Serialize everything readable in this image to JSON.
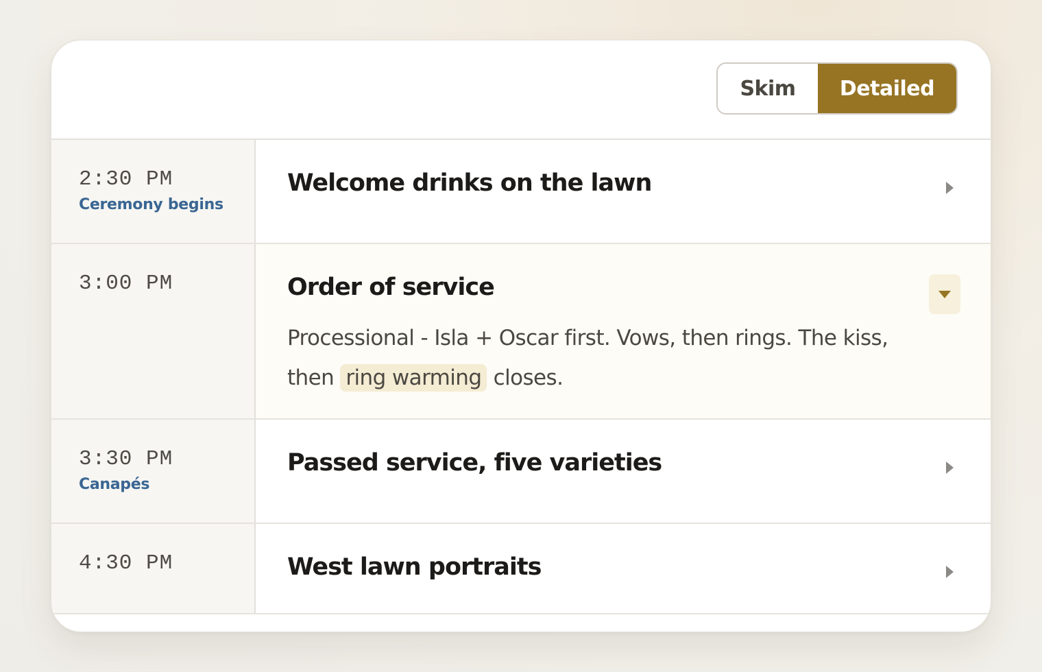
{
  "toggle": {
    "skim_label": "Skim",
    "detailed_label": "Detailed",
    "active": "Detailed"
  },
  "schedule": [
    {
      "time": "2:30 PM",
      "label": "Ceremony begins",
      "title": "Welcome drinks on the lawn",
      "expanded": false
    },
    {
      "time": "3:00 PM",
      "label": "",
      "title": "Order of service",
      "expanded": true,
      "description_before": "Processional - Isla + Oscar first. Vows, then rings. The kiss, then ",
      "description_highlight": "ring warming",
      "description_after": " closes."
    },
    {
      "time": "3:30 PM",
      "label": "Canapés",
      "title": "Passed service, five varieties",
      "expanded": false
    },
    {
      "time": "4:30 PM",
      "label": "",
      "title": "West lawn portraits",
      "expanded": false
    }
  ],
  "colors": {
    "accent": "#967424",
    "label_blue": "#3a6693",
    "highlight": "#f4ecd3"
  },
  "icons": {
    "collapsed": "chevron-right-icon",
    "expanded": "chevron-down-icon"
  }
}
